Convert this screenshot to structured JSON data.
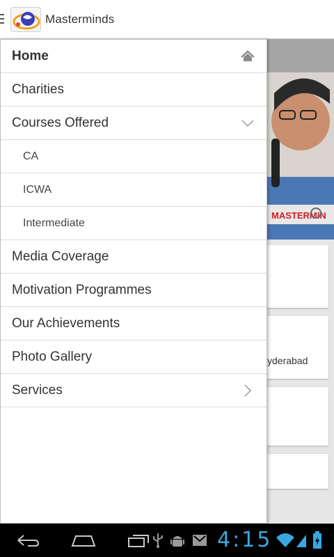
{
  "app": {
    "title": "Masterminds"
  },
  "menu": [
    {
      "label": "Home",
      "icon": "home-icon"
    },
    {
      "label": "Charities"
    },
    {
      "label": "Courses Offered",
      "icon": "chevron-down-icon"
    },
    {
      "label": "CA"
    },
    {
      "label": "ICWA"
    },
    {
      "label": "Intermediate"
    },
    {
      "label": "Media Coverage"
    },
    {
      "label": "Motivation Programmes"
    },
    {
      "label": "Our Achievements"
    },
    {
      "label": "Photo Gallery"
    },
    {
      "label": "Services",
      "icon": "chevron-right-icon"
    }
  ],
  "background": {
    "card_text": "yderabad"
  },
  "statusbar": {
    "time": "4:15"
  },
  "colors": {
    "clock": "#3aa8e0",
    "navbar": "#000000"
  }
}
